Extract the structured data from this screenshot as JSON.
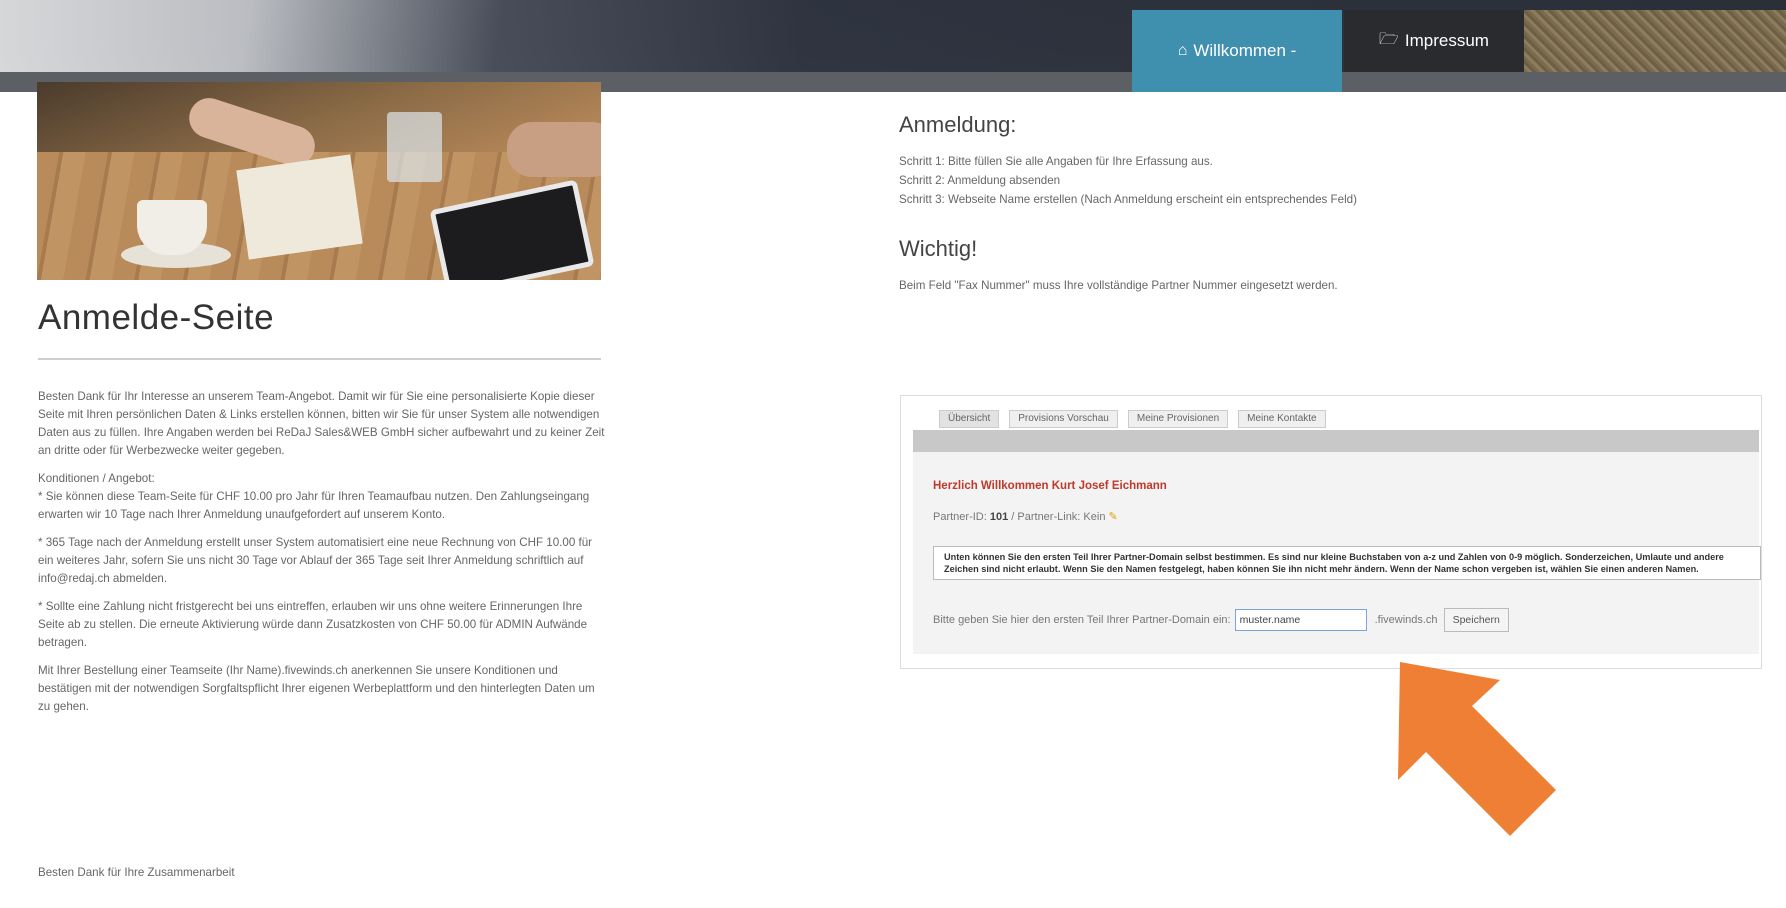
{
  "nav": {
    "home_label": "Willkommen -",
    "impressum_label": "Impressum",
    "home_icon": "home-icon",
    "impressum_icon": "folder-open-icon"
  },
  "left": {
    "title": "Anmelde-Seite",
    "intro": "Besten Dank für Ihr Interesse an unserem Team-Angebot. Damit wir für Sie eine personalisierte Kopie dieser Seite mit Ihren persönlichen Daten & Links erstellen können, bitten wir Sie für unser System alle notwendigen Daten aus zu füllen. Ihre Angaben werden bei ReDaJ Sales&WEB GmbH sicher aufbewahrt und zu keiner Zeit an dritte oder für Werbezwecke weiter gegeben.",
    "conditions": "Konditionen / Angebot:\n* Sie können diese Team-Seite für CHF 10.00 pro Jahr für Ihren Teamaufbau nutzen. Den Zahlungseingang erwarten wir 10 Tage nach Ihrer Anmeldung unaufgefordert auf unserem Konto.",
    "renewal": "* 365 Tage nach der Anmeldung erstellt unser System automatisiert eine neue Rechnung von CHF 10.00 für ein weiteres Jahr, sofern Sie uns nicht 30 Tage vor Ablauf der 365 Tage seit Ihrer Anmeldung schriftlich auf info@redaj.ch abmelden.",
    "nonpayment": "* Sollte eine Zahlung nicht fristgerecht bei uns eintreffen, erlauben wir uns ohne weitere Erinnerungen Ihre Seite ab zu stellen. Die erneute Aktivierung würde dann Zusatzkosten von CHF 50.00 für ADMIN Aufwände betragen.",
    "acceptance": "Mit Ihrer Bestellung einer Teamseite (Ihr Name).fivewinds.ch anerkennen Sie unsere Konditionen und bestätigen mit der notwendigen Sorgfaltspflicht Ihrer eigenen Werbeplattform und den hinterlegten Daten um zu gehen.",
    "thanks": "Besten Dank für Ihre Zusammenarbeit"
  },
  "right": {
    "heading": "Anmeldung:",
    "step1": "Schritt 1: Bitte füllen Sie alle Angaben für Ihre Erfassung aus.",
    "step2": "Schritt 2: Anmeldung absenden",
    "step3": "Schritt 3: Webseite Name erstellen (Nach Anmeldung erscheint ein entsprechendes Feld)",
    "important_heading": "Wichtig!",
    "important_text": "Beim Feld \"Fax Nummer\" muss Ihre vollständige Partner Nummer eingesetzt werden."
  },
  "panel": {
    "tabs": [
      "Übersicht",
      "Provisions Vorschau",
      "Meine Provisionen",
      "Meine Kontakte"
    ],
    "welcome": "Herzlich Willkommen Kurt Josef Eichmann",
    "partner_id_label": "Partner-ID:",
    "partner_id": "101",
    "partner_link_label": "/ Partner-Link: Kein",
    "info": "Unten können Sie den ersten Teil Ihrer Partner-Domain selbst bestimmen. Es sind nur kleine Buchstaben von a-z und Zahlen von 0-9 möglich. Sonderzeichen, Umlaute und andere Zeichen sind nicht erlaubt. Wenn Sie den Namen festgelegt, haben können Sie ihn nicht mehr ändern. Wenn der Name schon vergeben ist, wählen Sie einen anderen Namen.",
    "domain_prompt": "Bitte geben Sie hier den ersten Teil Ihrer Partner-Domain ein:",
    "domain_value": "muster.name",
    "domain_suffix": ".fivewinds.ch",
    "save_label": "Speichern"
  },
  "annotation": {
    "arrow_color": "#ee7f34"
  }
}
